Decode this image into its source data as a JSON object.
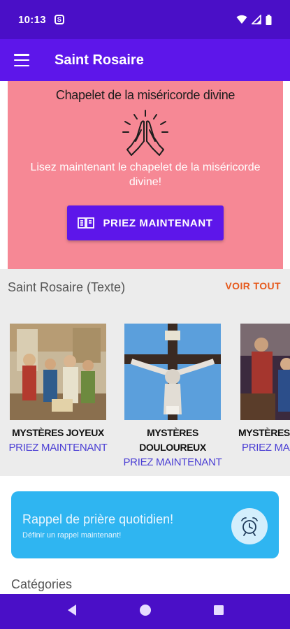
{
  "status_bar": {
    "time": "10:13",
    "sim_glyph": "S"
  },
  "app_bar": {
    "title": "Saint Rosaire"
  },
  "promo": {
    "title": "Chapelet de la miséricorde divine",
    "subtitle": "Lisez maintenant le chapelet de la miséricorde divine!",
    "button_label": "PRIEZ MAINTENANT",
    "background": "#f68895"
  },
  "rosary": {
    "header": "Saint Rosaire (Texte)",
    "see_all": "VOIR TOUT",
    "mysteries": [
      {
        "title": "MYSTÈRES JOYEUX",
        "link": "PRIEZ MAINTENANT"
      },
      {
        "title": "MYSTÈRES DOULOUREUX",
        "link": "PRIEZ MAINTENANT"
      },
      {
        "title": "MYSTÈRES",
        "link": "PRIEZ MAI"
      }
    ]
  },
  "reminder": {
    "title": "Rappel de prière quotidien!",
    "subtitle": "Définir un rappel maintenant!",
    "icon": "alarm-clock-icon"
  },
  "categories": {
    "header": "Catégories"
  },
  "colors": {
    "status_bar": "#4a0fc7",
    "app_bar": "#5d16ea",
    "accent": "#5d16ea",
    "see_all": "#e65a1d",
    "reminder": "#2fb5f1"
  }
}
